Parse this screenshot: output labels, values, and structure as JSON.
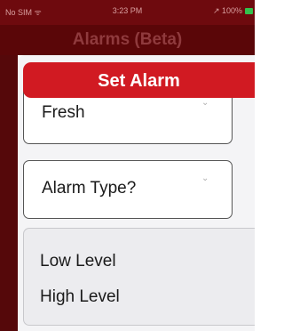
{
  "status_bar": {
    "carrier": "No SIM ᯤ",
    "time": "3:23 PM",
    "battery": "↗ 100%"
  },
  "nav": {
    "title": "Alarms (Beta)"
  },
  "sheet": {
    "title": "Set Alarm",
    "fluid_select": {
      "value": "Fresh",
      "icon": "chevron-down-icon"
    },
    "alarm_type_select": {
      "value": "Alarm Type?",
      "icon": "chevron-down-icon"
    },
    "options": [
      "Low Level",
      "High Level"
    ]
  },
  "colors": {
    "nav_background": "#5a0608",
    "header_red": "#d11a22",
    "battery_green": "#33c24d"
  }
}
